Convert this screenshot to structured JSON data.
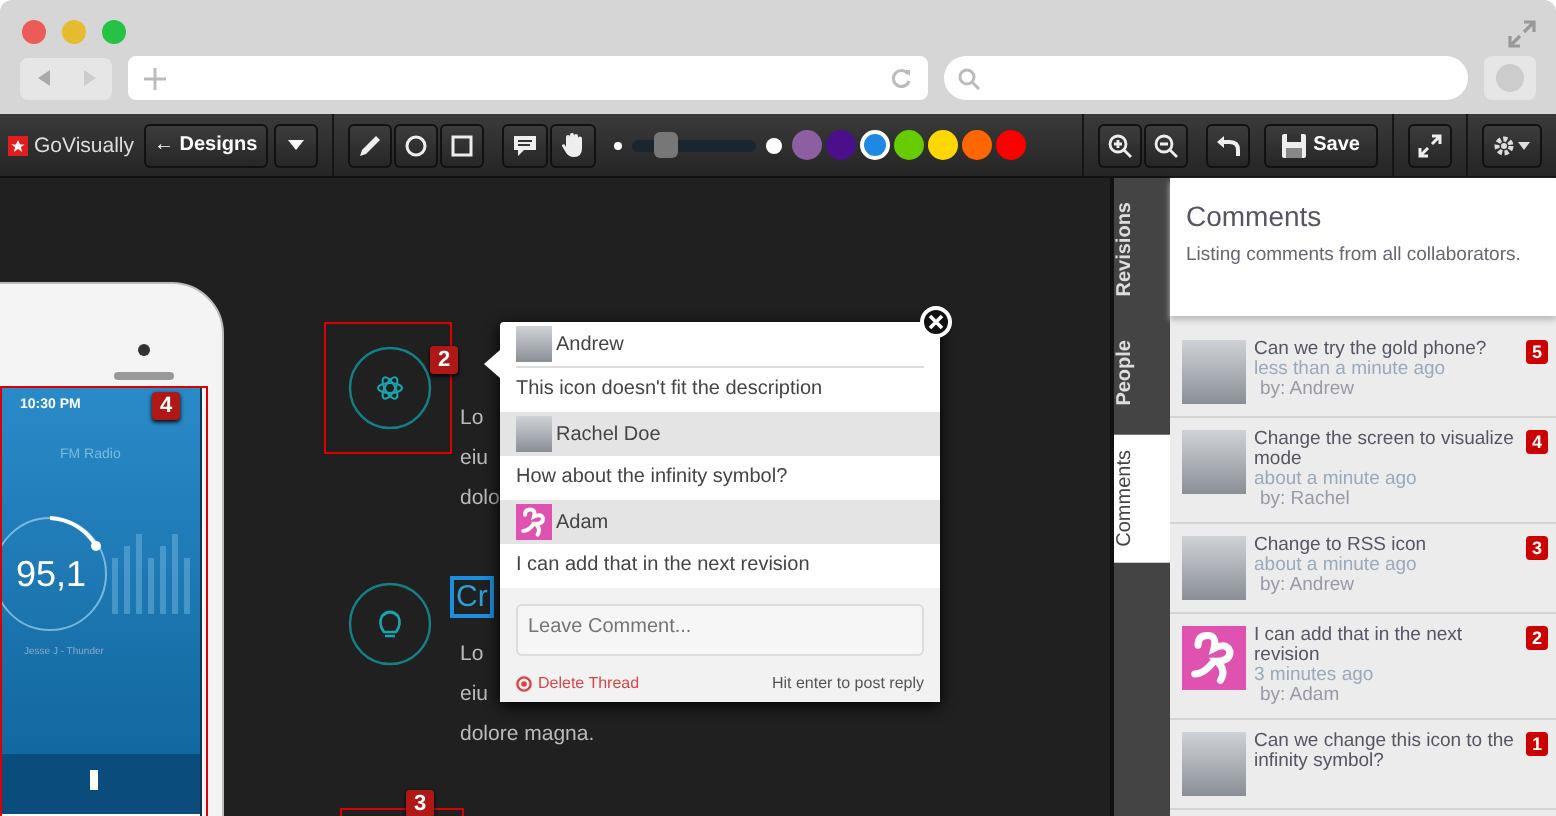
{
  "toolbar": {
    "logo": "GoVisually",
    "designs_button": "← Designs",
    "tools": [
      {
        "kind": "pencil"
      },
      {
        "kind": "circle"
      },
      {
        "kind": "square"
      },
      {
        "kind": "comment"
      },
      {
        "kind": "hand"
      }
    ],
    "stroke_slider": {
      "level": 0.28
    },
    "colors": [
      {
        "color": "#8e5ea2",
        "selected": false
      },
      {
        "color": "#4b0f8c",
        "selected": false
      },
      {
        "color": "#1e88e5",
        "selected": true
      },
      {
        "color": "#66cc00",
        "selected": false
      },
      {
        "color": "#ffd700",
        "selected": false
      },
      {
        "color": "#ff6600",
        "selected": false
      },
      {
        "color": "#ff0000",
        "selected": false
      }
    ],
    "save_button": "Save"
  },
  "canvas": {
    "phone": {
      "time": "10:30 PM",
      "station": "FM Radio",
      "frequency": "95,1",
      "track": "Jesse J - Thunder",
      "badge": "4"
    },
    "markers": [
      {
        "number": "2"
      },
      {
        "number": "3"
      }
    ],
    "text_block_1": [
      "Lo",
      "eiu",
      "dolo"
    ],
    "heading": "Cr",
    "text_block_2": [
      "Lo",
      "eiu",
      "dolore magna."
    ]
  },
  "popup": {
    "comments": [
      {
        "author": "Andrew",
        "kind": "photo",
        "text": "This icon doesn't fit the description"
      },
      {
        "author": "Rachel Doe",
        "kind": "photo",
        "text": "How about the infinity symbol?"
      },
      {
        "author": "Adam",
        "kind": "logo",
        "text": "I can add that in the next revision"
      }
    ],
    "placeholder": "Leave Comment...",
    "delete_label": "Delete Thread",
    "hint": "Hit enter to post reply"
  },
  "side_tabs": [
    {
      "label": "Revisions",
      "selected": false
    },
    {
      "label": "People",
      "selected": false
    },
    {
      "label": "Comments",
      "selected": true
    }
  ],
  "comments_panel": {
    "title": "Comments",
    "subtitle": "Listing comments from all collaborators.",
    "items": [
      {
        "text": "Can we try the gold phone?",
        "time": "less than a minute ago",
        "author": "by: Andrew",
        "number": "5",
        "kind": "photo"
      },
      {
        "text": "Change the screen to visualize mode",
        "time": "about a minute ago",
        "author": "by: Rachel",
        "number": "4",
        "kind": "photo"
      },
      {
        "text": "Change to RSS icon",
        "time": "about a minute ago",
        "author": "by: Andrew",
        "number": "3",
        "kind": "photo"
      },
      {
        "text": "I can add that in the next revision",
        "time": "3 minutes ago",
        "author": "by: Adam",
        "number": "2",
        "kind": "logo"
      },
      {
        "text": "Can we change this icon to the infinity symbol?",
        "number": "1",
        "kind": "photo"
      }
    ]
  }
}
